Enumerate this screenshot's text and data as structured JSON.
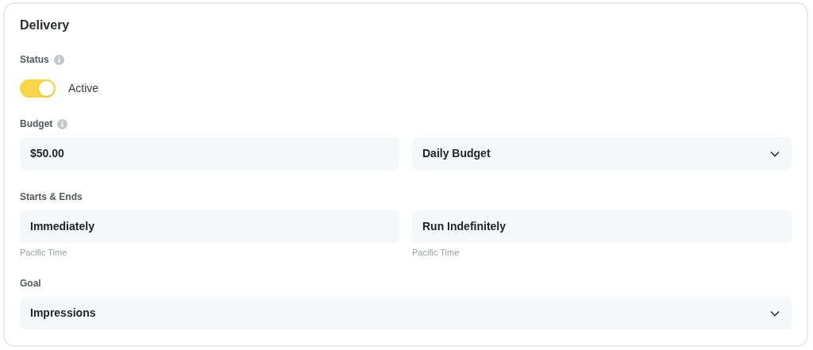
{
  "title": "Delivery",
  "status": {
    "label": "Status",
    "info": true,
    "on": true,
    "text": "Active"
  },
  "budget": {
    "label": "Budget",
    "info": true,
    "fields": [
      {
        "kind": "text",
        "value": "$50.00"
      },
      {
        "kind": "select",
        "value": "Daily Budget"
      }
    ]
  },
  "schedule": {
    "label": "Starts & Ends",
    "info": false,
    "fields": [
      {
        "kind": "text",
        "value": "Immediately",
        "hint": "Pacific Time"
      },
      {
        "kind": "text",
        "value": "Run Indefinitely",
        "hint": "Pacific Time"
      }
    ]
  },
  "goal": {
    "label": "Goal",
    "info": false,
    "fields": [
      {
        "kind": "select",
        "value": "Impressions"
      }
    ]
  }
}
